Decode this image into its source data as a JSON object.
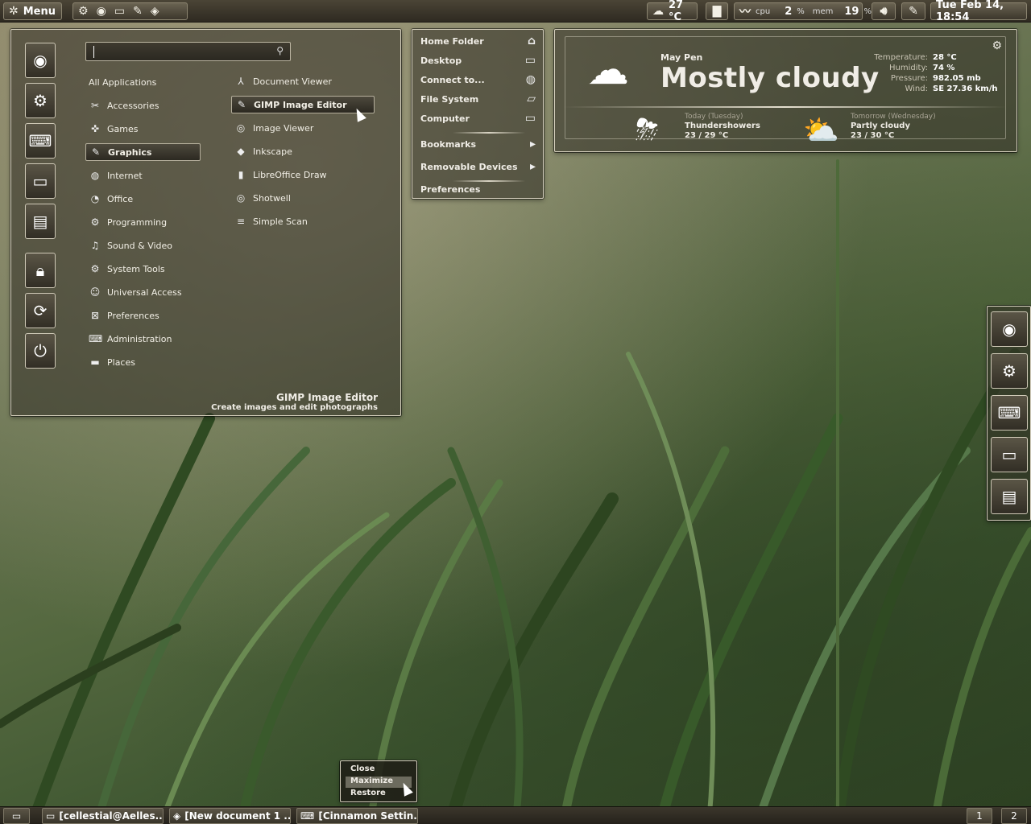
{
  "top_panel": {
    "menu_label": "Menu",
    "launchers": [
      "settings-icon",
      "firefox-icon",
      "terminal-icon",
      "gimp-icon",
      "inkscape-icon"
    ],
    "weather_temp": "27 °C",
    "sysmon": {
      "cpu_label": "cpu",
      "cpu_value": "2",
      "mem_label": "mem",
      "mem_value": "19",
      "percent": "%"
    },
    "clock": "Tue Feb 14, 18:54"
  },
  "menu": {
    "search_placeholder": "",
    "categories": [
      {
        "label": "All Applications",
        "icon": "none"
      },
      {
        "label": "Accessories",
        "icon": "accessories-icon"
      },
      {
        "label": "Games",
        "icon": "gamepad-icon"
      },
      {
        "label": "Graphics",
        "icon": "graphics-icon"
      },
      {
        "label": "Internet",
        "icon": "globe-icon"
      },
      {
        "label": "Office",
        "icon": "office-icon"
      },
      {
        "label": "Programming",
        "icon": "gears-icon"
      },
      {
        "label": "Sound & Video",
        "icon": "media-icon"
      },
      {
        "label": "System Tools",
        "icon": "gear-icon"
      },
      {
        "label": "Universal Access",
        "icon": "accessibility-icon"
      },
      {
        "label": "Preferences",
        "icon": "preferences-icon"
      },
      {
        "label": "Administration",
        "icon": "admin-icon"
      },
      {
        "label": "Places",
        "icon": "folder-icon"
      }
    ],
    "selected_category": "Graphics",
    "apps": [
      {
        "label": "Document Viewer",
        "icon": "pdf-icon"
      },
      {
        "label": "GIMP Image Editor",
        "icon": "gimp-icon"
      },
      {
        "label": "Image Viewer",
        "icon": "eye-icon"
      },
      {
        "label": "Inkscape",
        "icon": "inkscape-icon"
      },
      {
        "label": "LibreOffice Draw",
        "icon": "draw-icon"
      },
      {
        "label": "Shotwell",
        "icon": "shotwell-icon"
      },
      {
        "label": "Simple Scan",
        "icon": "scanner-icon"
      }
    ],
    "selected_app": "GIMP Image Editor",
    "footer_title": "GIMP Image Editor",
    "footer_desc": "Create images and edit photographs"
  },
  "places": {
    "items": [
      {
        "label": "Home Folder",
        "icon": "home-icon"
      },
      {
        "label": "Desktop",
        "icon": "desktop-icon"
      },
      {
        "label": "Connect to...",
        "icon": "globe-icon"
      },
      {
        "label": "File System",
        "icon": "drive-icon"
      },
      {
        "label": "Computer",
        "icon": "computer-icon"
      },
      {
        "label": "Bookmarks",
        "icon": "arrow-right-icon"
      },
      {
        "label": "Removable Devices",
        "icon": "arrow-right-icon"
      },
      {
        "label": "Preferences",
        "icon": "none"
      }
    ]
  },
  "weather": {
    "location": "May  Pen",
    "condition": "Mostly cloudy",
    "stats": [
      {
        "label": "Temperature:",
        "value": "28 °C"
      },
      {
        "label": "Humidity:",
        "value": "74 %"
      },
      {
        "label": "Pressure:",
        "value": "982.05 mb"
      },
      {
        "label": "Wind:",
        "value": "SE 27.36 km/h"
      }
    ],
    "today": {
      "day": "Today (Tuesday)",
      "condition": "Thundershowers",
      "range": "23 / 29 °C"
    },
    "tomorrow": {
      "day": "Tomorrow (Wednesday)",
      "condition": "Partly cloudy",
      "range": "23 / 30 °C"
    }
  },
  "context_menu": {
    "items": [
      "Close",
      "Maximize",
      "Restore"
    ],
    "highlighted": "Maximize"
  },
  "taskbar": {
    "tasks": [
      {
        "label": "[cellestial@Aelles..."
      },
      {
        "label": "[New document 1 ..."
      },
      {
        "label": "[Cinnamon Settin..."
      }
    ],
    "workspaces": [
      "1",
      "2"
    ]
  }
}
